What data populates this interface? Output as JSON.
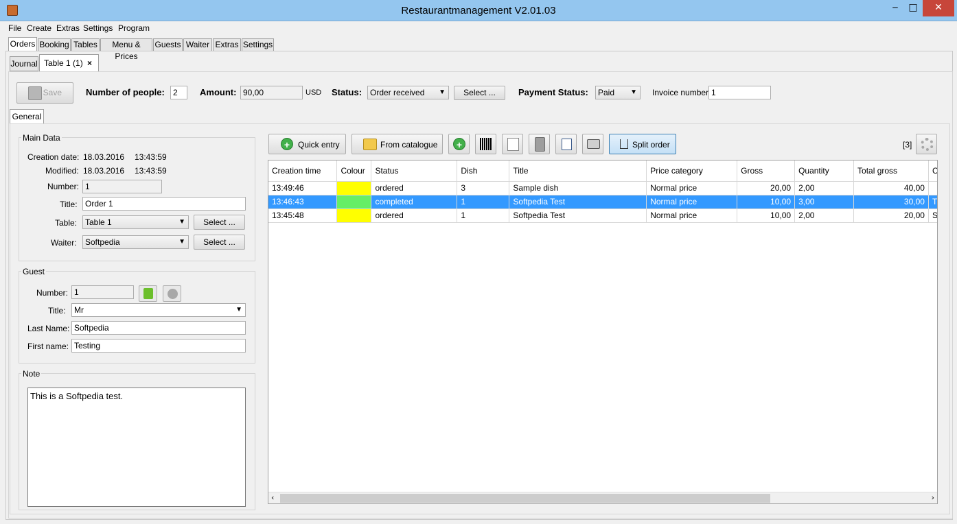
{
  "window": {
    "title": "Restaurantmanagement V2.01.03",
    "min": "‒",
    "max": "□",
    "close": "✕"
  },
  "menu": [
    "File",
    "Create",
    "Extras",
    "Settings",
    "Program"
  ],
  "main_tabs": [
    "Orders",
    "Booking",
    "Tables",
    "Menu & Prices",
    "Guests",
    "Waiter",
    "Extras",
    "Settings"
  ],
  "sub_tabs": {
    "journal": "Journal",
    "table": "Table 1 (1)",
    "close": "×"
  },
  "toolbar": {
    "save_label": "Save",
    "people_label": "Number of people:",
    "people_value": "2",
    "amount_label": "Amount:",
    "amount_value": "90,00",
    "currency": "USD",
    "status_label": "Status:",
    "status_value": "Order received",
    "select_label": "Select ...",
    "payment_label": "Payment Status:",
    "payment_value": "Paid",
    "invoice_label": "Invoice number:",
    "invoice_value": "1"
  },
  "general_tab": "General",
  "main_data": {
    "title": "Main Data",
    "creation_label": "Creation date:",
    "creation_date": "18.03.2016",
    "creation_time": "13:43:59",
    "modified_label": "Modified:",
    "modified_date": "18.03.2016",
    "modified_time": "13:43:59",
    "number_label": "Number:",
    "number_value": "1",
    "title_label": "Title:",
    "title_value": "Order 1",
    "table_label": "Table:",
    "table_value": "Table 1",
    "waiter_label": "Waiter:",
    "waiter_value": "Softpedia",
    "select_label": "Select ..."
  },
  "guest": {
    "title": "Guest",
    "number_label": "Number:",
    "number_value": "1",
    "title_label": "Title:",
    "title_value": "Mr",
    "last_label": "Last Name:",
    "last_value": "Softpedia",
    "first_label": "First name:",
    "first_value": "Testing"
  },
  "note": {
    "title": "Note",
    "text": "This is a Softpedia test."
  },
  "order_toolbar": {
    "quick_entry": "Quick entry",
    "from_catalogue": "From catalogue",
    "split_order": "Split order",
    "count": "[3]"
  },
  "table": {
    "columns": [
      "Creation time",
      "Colour",
      "Status",
      "Dish",
      "Title",
      "Price category",
      "Gross",
      "Quantity",
      "Total gross",
      "C"
    ],
    "rows": [
      {
        "time": "13:49:46",
        "colour": "#ffff00",
        "status": "ordered",
        "dish": "3",
        "title": "Sample dish",
        "price_category": "Normal price",
        "gross": "20,00",
        "quantity": "2,00",
        "total": "40,00",
        "c": ""
      },
      {
        "time": "13:46:43",
        "colour": "#66ee66",
        "status": "completed",
        "dish": "1",
        "title": "Softpedia Test",
        "price_category": "Normal price",
        "gross": "10,00",
        "quantity": "3,00",
        "total": "30,00",
        "c": "T"
      },
      {
        "time": "13:45:48",
        "colour": "#ffff00",
        "status": "ordered",
        "dish": "1",
        "title": "Softpedia Test",
        "price_category": "Normal price",
        "gross": "10,00",
        "quantity": "2,00",
        "total": "20,00",
        "c": "S"
      }
    ]
  },
  "colors": {
    "titlebar": "#94c6ef",
    "selection": "#3399ff",
    "close": "#c7463a"
  }
}
